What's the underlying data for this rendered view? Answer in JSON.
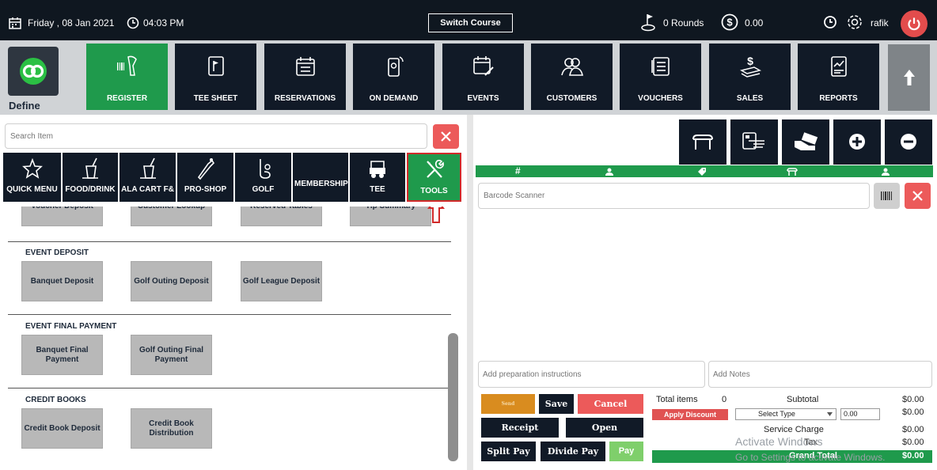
{
  "topbar": {
    "date": "Friday , 08 Jan 2021",
    "time": "04:03 PM",
    "switch_course": "Switch Course",
    "rounds": "0 Rounds",
    "balance": "0.00",
    "user": "rafik"
  },
  "nav": {
    "brand": "Define",
    "items": [
      {
        "label": "REGISTER",
        "icon": "barcode-scanner-icon",
        "active": true
      },
      {
        "label": "TEE SHEET",
        "icon": "flag-icon"
      },
      {
        "label": "RESERVATIONS",
        "icon": "calendar-icon"
      },
      {
        "label": "ON DEMAND",
        "icon": "mobile-icon"
      },
      {
        "label": "EVENTS",
        "icon": "calendar-edit-icon"
      },
      {
        "label": "CUSTOMERS",
        "icon": "users-icon"
      },
      {
        "label": "VOUCHERS",
        "icon": "list-icon"
      },
      {
        "label": "SALES",
        "icon": "money-icon"
      },
      {
        "label": "REPORTS",
        "icon": "report-icon"
      }
    ]
  },
  "search": {
    "placeholder": "Search Item"
  },
  "categories": [
    {
      "label": "QUICK MENU",
      "icon": "star-icon"
    },
    {
      "label": "FOOD/DRINK",
      "icon": "drink-icon"
    },
    {
      "label": "ALA CART F&",
      "icon": "drink-icon"
    },
    {
      "label": "PRO-SHOP",
      "icon": "golf-club-icon"
    },
    {
      "label": "GOLF",
      "icon": "golf-icon"
    },
    {
      "label": "MEMBERSHIP",
      "icon": ""
    },
    {
      "label": "TEE",
      "icon": "golf-cart-icon"
    },
    {
      "label": "TOOLS",
      "icon": "tools-icon",
      "selected": true
    }
  ],
  "partial_row": [
    "Voucher Deposit",
    "Customer Lookup",
    "Reserved Tables",
    "Tip Summary"
  ],
  "sections": [
    {
      "title": "EVENT DEPOSIT",
      "items": [
        "Banquet Deposit",
        "Golf Outing Deposit",
        "Golf League Deposit"
      ]
    },
    {
      "title": "EVENT FINAL PAYMENT",
      "items": [
        "Banquet Final Payment",
        "Golf Outing Final Payment"
      ]
    },
    {
      "title": "CREDIT BOOKS",
      "items": [
        "Credit Book Deposit",
        "Credit Book Distribution"
      ]
    }
  ],
  "order": {
    "columns": [
      "#",
      "person",
      "tag",
      "seat",
      "user"
    ],
    "barcode_placeholder": "Barcode Scanner",
    "prep_placeholder": "Add preparation instructions",
    "notes_placeholder": "Add Notes"
  },
  "actions": {
    "send": "Send",
    "save": "Save",
    "cancel": "Cancel",
    "receipt": "Receipt",
    "open": "Open",
    "split_pay": "Split Pay",
    "divide_pay": "Divide Pay",
    "pay": "Pay"
  },
  "totals": {
    "total_items_label": "Total items",
    "total_items": "0",
    "subtotal_label": "Subtotal",
    "subtotal": "$0.00",
    "apply_discount": "Apply Discount",
    "select_type": "Select Type",
    "discount_value": "0.00",
    "discount": "$0.00",
    "service_charge_label": "Service Charge",
    "service_charge": "$0.00",
    "tax_label": "Tax",
    "tax": "$0.00",
    "grand_total_label": "Grand Total",
    "grand_total": "$0.00"
  },
  "watermark": {
    "line1": "Activate Windows",
    "line2": "Go to Settings to activate Windows."
  },
  "colors": {
    "dark": "#111a27",
    "green": "#1f9a4c",
    "red": "#ec5a5a",
    "gray_item": "#b8b8b8"
  }
}
